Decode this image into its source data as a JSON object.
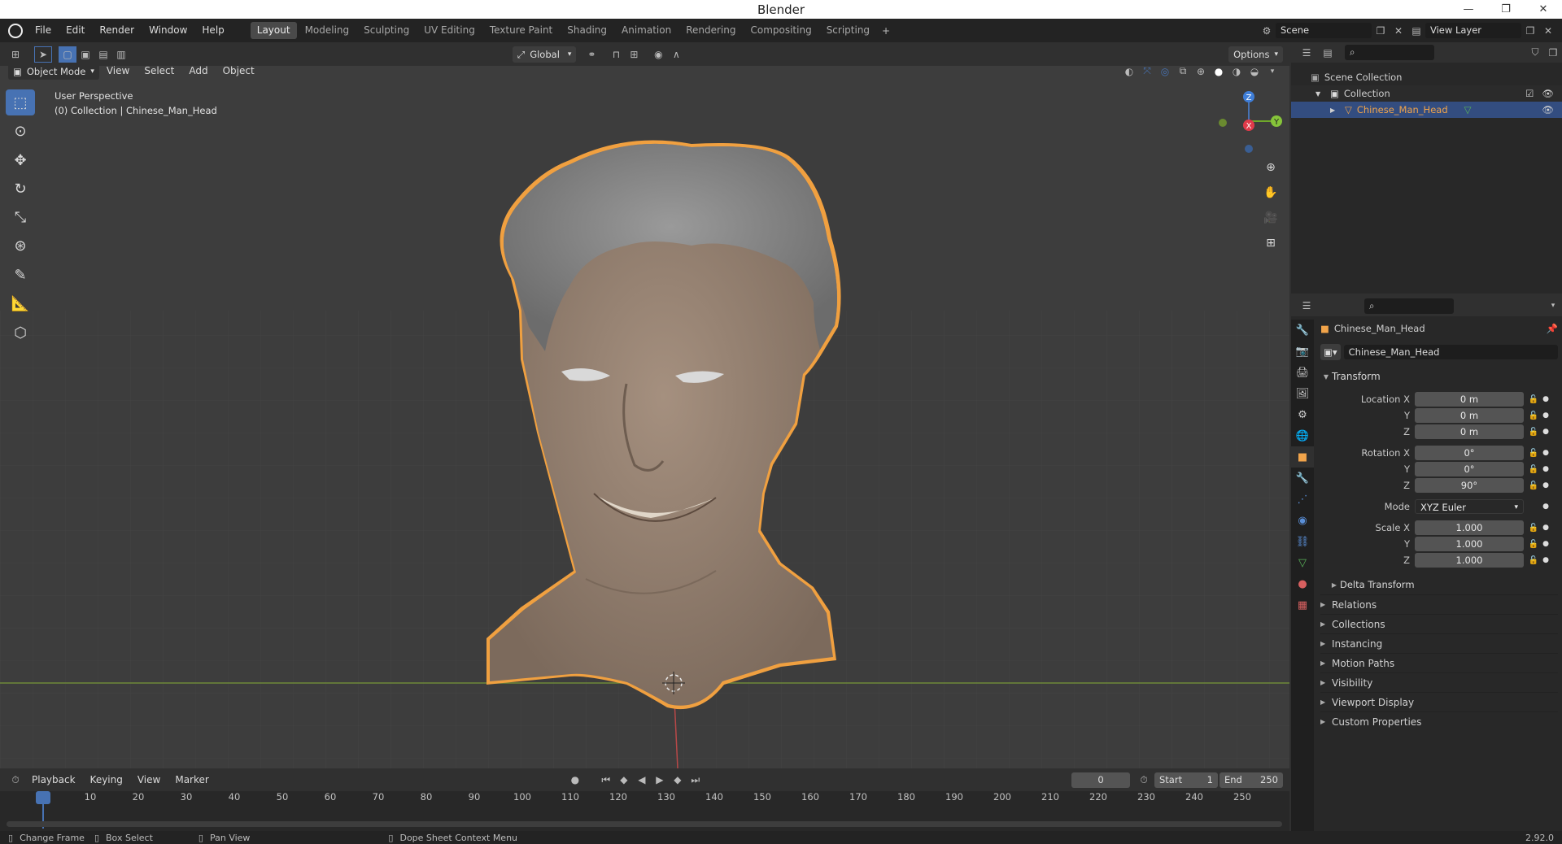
{
  "window": {
    "title": "Blender",
    "minimize": "—",
    "restore": "❐",
    "close": "✕"
  },
  "menu": [
    "File",
    "Edit",
    "Render",
    "Window",
    "Help"
  ],
  "workspaces": [
    "Layout",
    "Modeling",
    "Sculpting",
    "UV Editing",
    "Texture Paint",
    "Shading",
    "Animation",
    "Rendering",
    "Compositing",
    "Scripting"
  ],
  "active_workspace": "Layout",
  "scene": {
    "name": "Scene",
    "view_layer": "View Layer"
  },
  "viewport": {
    "transform_orientation": "Global",
    "options_label": "Options",
    "mode": "Object Mode",
    "header_menus": [
      "View",
      "Select",
      "Add",
      "Object"
    ],
    "overlay_title": "User Perspective",
    "overlay_sub": "(0) Collection | Chinese_Man_Head",
    "gizmo": {
      "z": "Z",
      "y": "Y",
      "x": "X"
    }
  },
  "outliner": {
    "root": "Scene Collection",
    "collection": "Collection",
    "object": "Chinese_Man_Head"
  },
  "properties": {
    "object_name": "Chinese_Man_Head",
    "data_name": "Chinese_Man_Head",
    "transform_title": "Transform",
    "location": {
      "label": "Location X",
      "x": "0 m",
      "y": "0 m",
      "z": "0 m"
    },
    "rotation": {
      "label": "Rotation X",
      "x": "0°",
      "y": "0°",
      "z": "90°"
    },
    "mode_label": "Mode",
    "mode_value": "XYZ Euler",
    "scale": {
      "label": "Scale X",
      "x": "1.000",
      "y": "1.000",
      "z": "1.000"
    },
    "axis_y": "Y",
    "axis_z": "Z",
    "delta": "Delta Transform",
    "panels": [
      "Relations",
      "Collections",
      "Instancing",
      "Motion Paths",
      "Visibility",
      "Viewport Display",
      "Custom Properties"
    ]
  },
  "timeline": {
    "menus": [
      "Playback",
      "Keying",
      "View",
      "Marker"
    ],
    "current_frame": "0",
    "start_label": "Start",
    "start": "1",
    "end_label": "End",
    "end": "250",
    "ticks": [
      "0",
      "10",
      "20",
      "30",
      "40",
      "50",
      "60",
      "70",
      "80",
      "90",
      "100",
      "110",
      "120",
      "130",
      "140",
      "150",
      "160",
      "170",
      "180",
      "190",
      "200",
      "210",
      "220",
      "230",
      "240",
      "250"
    ]
  },
  "status": {
    "change_frame": "Change Frame",
    "box_select": "Box Select",
    "pan_view": "Pan View",
    "context_menu": "Dope Sheet Context Menu",
    "version": "2.92.0"
  },
  "colors": {
    "accent": "#4772b3",
    "selection": "#f0a040",
    "object_text": "#f1a44a"
  }
}
